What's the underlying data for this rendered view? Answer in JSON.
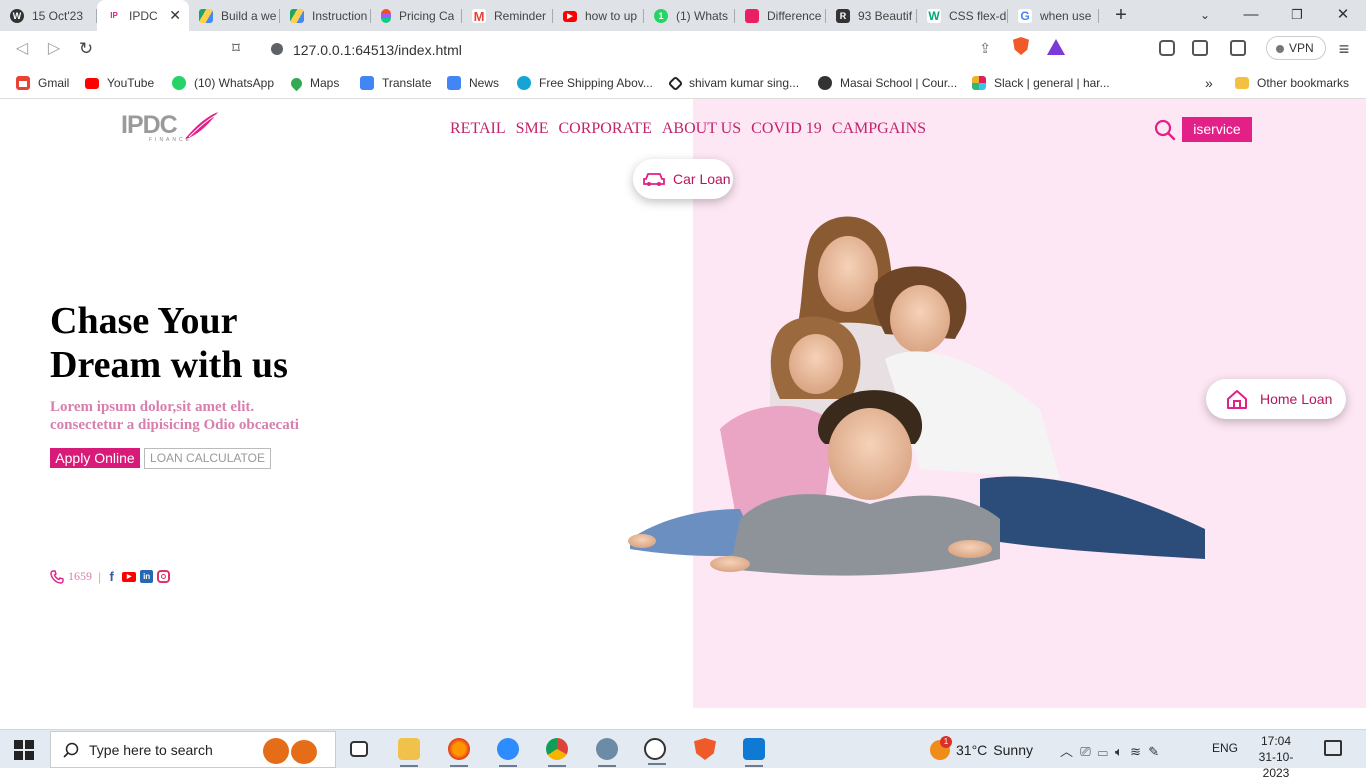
{
  "browser": {
    "tabs": [
      {
        "title": "15 Oct'23",
        "icon": "wordpress-icon",
        "color": "#333333"
      },
      {
        "title": "IPDC",
        "icon": "ipdc-favicon",
        "color": "#e31f88",
        "active": true
      },
      {
        "title": "Build a we",
        "icon": "google-drive-icon",
        "color": "#1fa463"
      },
      {
        "title": "Instruction",
        "icon": "google-drive-icon",
        "color": "#1fa463"
      },
      {
        "title": "Pricing Ca",
        "icon": "figma-icon",
        "color": "#f24e1e"
      },
      {
        "title": "Reminder",
        "icon": "gmail-icon",
        "color": "#ea4335"
      },
      {
        "title": "how to up",
        "icon": "youtube-icon",
        "color": "#ff0000"
      },
      {
        "title": "(1) Whats",
        "icon": "whatsapp-icon",
        "color": "#25d366"
      },
      {
        "title": "Difference",
        "icon": "cube-icon",
        "color": "#e91e63"
      },
      {
        "title": "93 Beautif",
        "icon": "dribbble-icon",
        "color": "#333333"
      },
      {
        "title": "CSS flex-d",
        "icon": "w3schools-icon",
        "color": "#04aa6d"
      },
      {
        "title": "when use",
        "icon": "google-icon",
        "color": "#4285f4"
      }
    ],
    "url": "127.0.0.1:64513/index.html",
    "vpn_label": "VPN",
    "bookmarks": [
      {
        "label": "Gmail",
        "icon": "gmail-icon",
        "color": "#ea4335"
      },
      {
        "label": "YouTube",
        "icon": "youtube-icon",
        "color": "#ff0000"
      },
      {
        "label": "(10) WhatsApp",
        "icon": "whatsapp-icon",
        "color": "#25d366"
      },
      {
        "label": "Maps",
        "icon": "maps-icon",
        "color": "#34a853"
      },
      {
        "label": "Translate",
        "icon": "translate-icon",
        "color": "#4285f4"
      },
      {
        "label": "News",
        "icon": "news-icon",
        "color": "#4285f4"
      },
      {
        "label": "Free Shipping Abov...",
        "icon": "myntra-icon",
        "color": "#14a4d6"
      },
      {
        "label": "shivam kumar sing...",
        "icon": "github-icon",
        "color": "#222222"
      },
      {
        "label": "Masai School | Cour...",
        "icon": "masai-icon",
        "color": "#333333"
      },
      {
        "label": "Slack | general | har...",
        "icon": "slack-icon",
        "color": "#e01e5a"
      }
    ],
    "bookmarks_overflow": "»",
    "other_bookmarks": "Other bookmarks"
  },
  "site": {
    "brand_color": "#e31f88",
    "panel_color": "#fde7f4",
    "logo_text": "IPDC",
    "logo_sub": "FINANCE",
    "nav": [
      "RETAIL",
      "SME",
      "CORPORATE",
      "ABOUT US",
      "COVID 19",
      "CAMPGAINS"
    ],
    "iservice_label": "iservice",
    "car_loan_label": "Car Loan",
    "home_loan_label": "Home Loan",
    "hero_title_line1": "Chase Your",
    "hero_title_line2": "Dream with us",
    "hero_sub_line1": "Lorem ipsum dolor,sit amet elit.",
    "hero_sub_line2": "consectetur a dipisicing Odio obcaecati",
    "apply_label": "Apply Online",
    "loan_calc_label": "LOAN CALCULATOE",
    "hotline": "1659",
    "social_icons": [
      "facebook-icon",
      "youtube-icon",
      "linkedin-icon",
      "instagram-icon"
    ]
  },
  "taskbar": {
    "search_placeholder": "Type here to search",
    "weather_temp": "31°C",
    "weather_text": "Sunny",
    "weather_badge": "1",
    "lang": "ENG",
    "time": "17:04",
    "date": "31-10-2023",
    "apps": [
      "task-view-icon",
      "file-explorer-icon",
      "firefox-icon",
      "zoom-icon",
      "chrome-icon",
      "edge-icon",
      "cypress-icon",
      "brave-icon",
      "vscode-icon"
    ]
  }
}
